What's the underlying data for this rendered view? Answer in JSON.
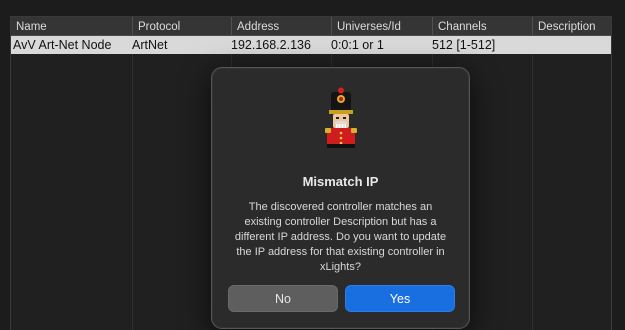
{
  "table": {
    "columns": [
      "Name",
      "Protocol",
      "Address",
      "Universes/Id",
      "Channels",
      "Description"
    ],
    "rows": [
      [
        "AvV Art-Net Node",
        "ArtNet",
        "192.168.2.136",
        "0:0:1 or 1",
        "512 [1-512]",
        ""
      ]
    ],
    "selected_row_color": "#d9d9d9"
  },
  "dialog": {
    "icon": "xlights-nutcracker-icon",
    "title": "Mismatch IP",
    "message": "The discovered controller matches an existing controller Description but has a different IP address. Do you want to update the IP address for that existing controller in xLights?",
    "no_label": "No",
    "yes_label": "Yes",
    "accent_color": "#1a6fe0"
  }
}
